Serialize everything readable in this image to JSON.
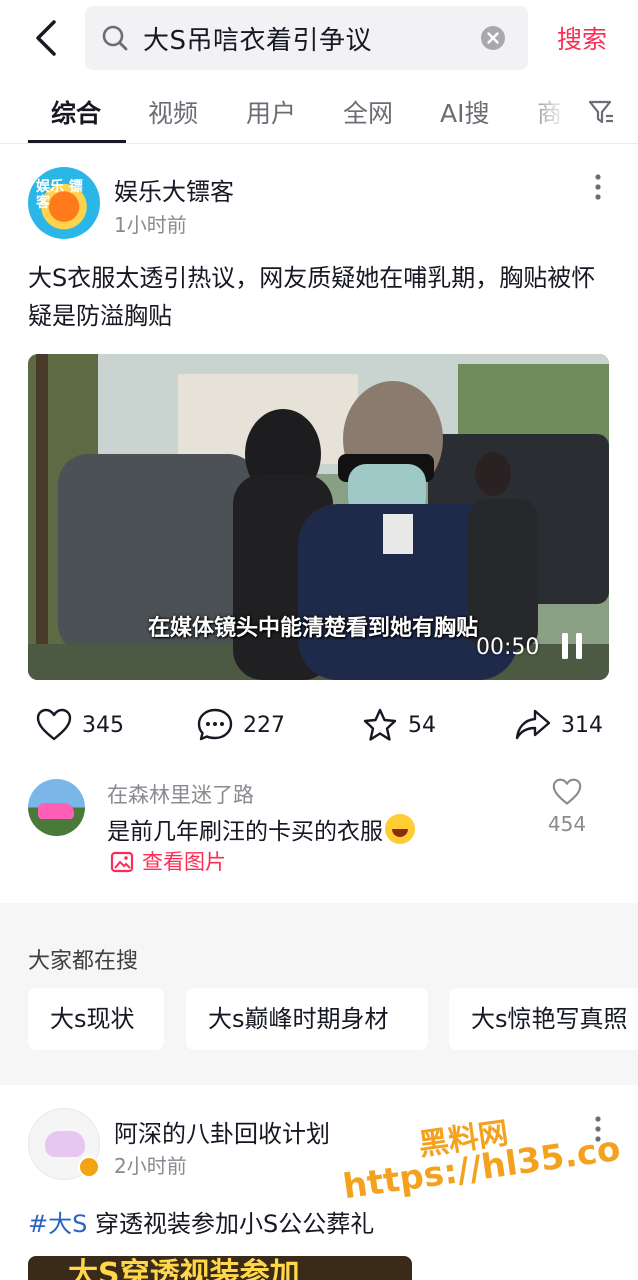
{
  "search": {
    "query": "大S吊唁衣着引争议",
    "button_label": "搜索"
  },
  "tabs": [
    {
      "label": "综合"
    },
    {
      "label": "视频"
    },
    {
      "label": "用户"
    },
    {
      "label": "全网"
    },
    {
      "label": "AI搜"
    },
    {
      "label": "商"
    }
  ],
  "post1": {
    "author": "娱乐大镖客",
    "avatar_text": "娱乐 镖 客",
    "time": "1小时前",
    "description": "大S衣服太透引热议，网友质疑她在哺乳期，胸贴被怀疑是防溢胸贴",
    "video": {
      "caption": "在媒体镜头中能清楚看到她有胸贴",
      "duration": "00:50"
    },
    "likes": "345",
    "comments": "227",
    "favorites": "54",
    "shares": "314"
  },
  "top_comment": {
    "user": "在森林里迷了路",
    "text": "是前几年刷汪的卡买的衣服",
    "view_image_label": "查看图片",
    "likes": "454"
  },
  "hot_searches": {
    "title": "大家都在搜",
    "items": [
      "大s现状",
      "大s巅峰时期身材",
      "大s惊艳写真照"
    ]
  },
  "post2": {
    "author": "阿深的八卦回收计划",
    "time": "2小时前",
    "hashtag": "#大S",
    "description": " 穿透视装参加小S公公葬礼",
    "thumbnail_text": "大S穿透视装参加"
  },
  "watermark": {
    "line1": "黑料网",
    "line2": "https://hl35.co"
  },
  "colors": {
    "accent": "#fe2c55",
    "hashtag": "#2a64c5",
    "watermark": "#f4a11e"
  }
}
